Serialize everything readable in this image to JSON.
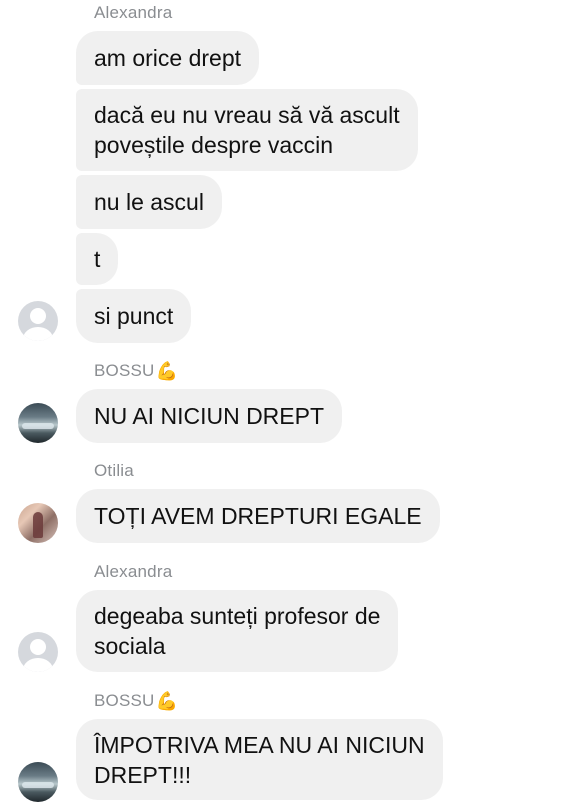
{
  "chat": {
    "messages": [
      {
        "sender": "Alexandra",
        "sender_emoji": "",
        "lines": [
          "am orice drept"
        ]
      },
      {
        "sender": "",
        "lines": [
          "dacă eu nu vreau să vă ascult",
          "poveștile despre vaccin"
        ]
      },
      {
        "sender": "",
        "lines": [
          "nu le ascul"
        ]
      },
      {
        "sender": "",
        "lines": [
          "t"
        ]
      },
      {
        "sender": "",
        "lines": [
          "si punct"
        ]
      },
      {
        "sender": "BOSSU",
        "sender_emoji": "💪",
        "lines": [
          "NU AI NICIUN DREPT"
        ]
      },
      {
        "sender": "Otilia",
        "sender_emoji": "",
        "lines": [
          "TOȚI AVEM DREPTURI EGALE"
        ]
      },
      {
        "sender": "Alexandra",
        "sender_emoji": "",
        "lines": [
          "degeaba sunteți profesor de",
          "sociala"
        ]
      },
      {
        "sender": "BOSSU",
        "sender_emoji": "💪",
        "lines": [
          "ÎMPOTRIVA MEA NU AI NICIUN",
          "DREPT!!!"
        ]
      }
    ]
  },
  "icons": {
    "default_avatar": "person-placeholder-icon",
    "flex_emoji": "flexed-biceps-emoji"
  },
  "colors": {
    "bubble_bg": "#f0f0f0",
    "sender_text": "#8a8d91",
    "message_text": "#111111"
  }
}
